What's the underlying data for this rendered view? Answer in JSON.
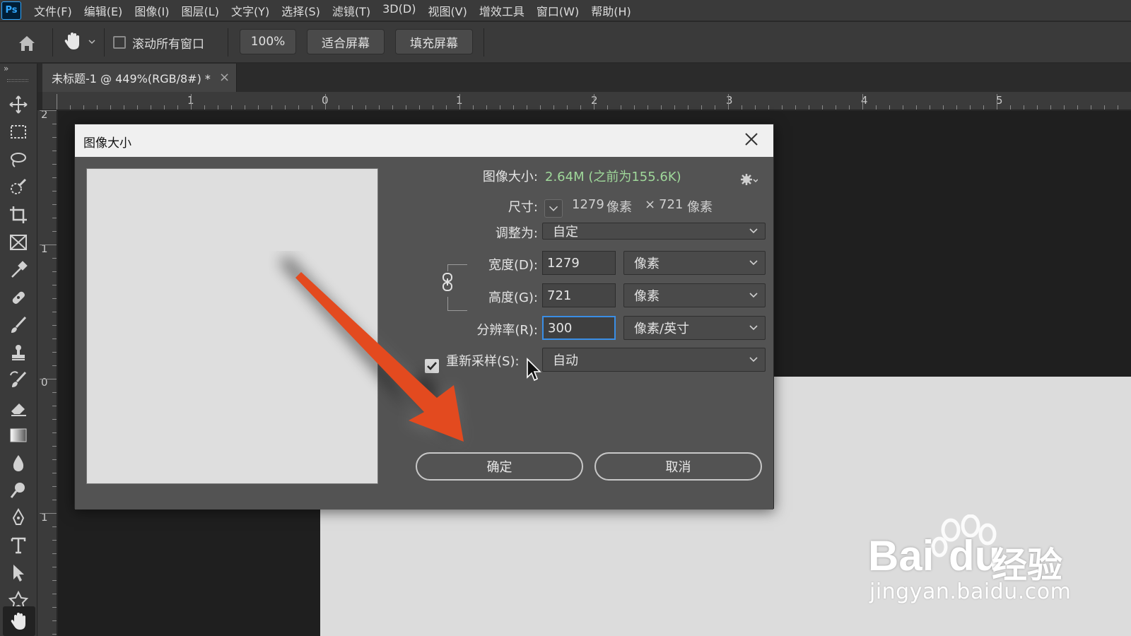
{
  "app": {
    "logo": "Ps",
    "menu": [
      "文件(F)",
      "编辑(E)",
      "图像(I)",
      "图层(L)",
      "文字(Y)",
      "选择(S)",
      "滤镜(T)",
      "3D(D)",
      "视图(V)",
      "增效工具",
      "窗口(W)",
      "帮助(H)"
    ]
  },
  "options_bar": {
    "scroll_all_label": "滚动所有窗口",
    "zoom_label": "100%",
    "fit_screen_label": "适合屏幕",
    "fill_screen_label": "填充屏幕"
  },
  "toolbar": {
    "collapse": "»"
  },
  "document": {
    "tab_title": "未标题-1 @ 449%(RGB/8#) *",
    "tab_close": "×"
  },
  "rulers": {
    "h": [
      "1",
      "0",
      "1",
      "2",
      "3",
      "4",
      "5"
    ],
    "v": [
      "2",
      "1",
      "0",
      "1"
    ]
  },
  "dialog": {
    "title": "图像大小",
    "close": "✕",
    "image_size_label": "图像大小:",
    "image_size_value": "2.64M (之前为155.6K)",
    "dimensions_label": "尺寸:",
    "dimensions_width": "1279",
    "dimensions_unit1": "像素",
    "dimensions_x": "×",
    "dimensions_height": "721",
    "dimensions_unit2": "像素",
    "fit_to_label": "调整为:",
    "fit_to_value": "自定",
    "width_label": "宽度(D):",
    "width_value": "1279",
    "width_unit": "像素",
    "height_label": "高度(G):",
    "height_value": "721",
    "height_unit": "像素",
    "resolution_label": "分辨率(R):",
    "resolution_value": "300",
    "resolution_unit": "像素/英寸",
    "resample_label": "重新采样(S):",
    "resample_value": "自动",
    "resample_checked": true,
    "ok_label": "确定",
    "cancel_label": "取消"
  },
  "watermark": {
    "brand_a": "Bai",
    "brand_b": "du",
    "brand_c": "经验",
    "url": "jingyan.baidu.com"
  },
  "colors": {
    "accent_arrow": "#e34a1f",
    "focus_blue": "#3a8ee6",
    "size_value_green": "#9fd89a"
  }
}
